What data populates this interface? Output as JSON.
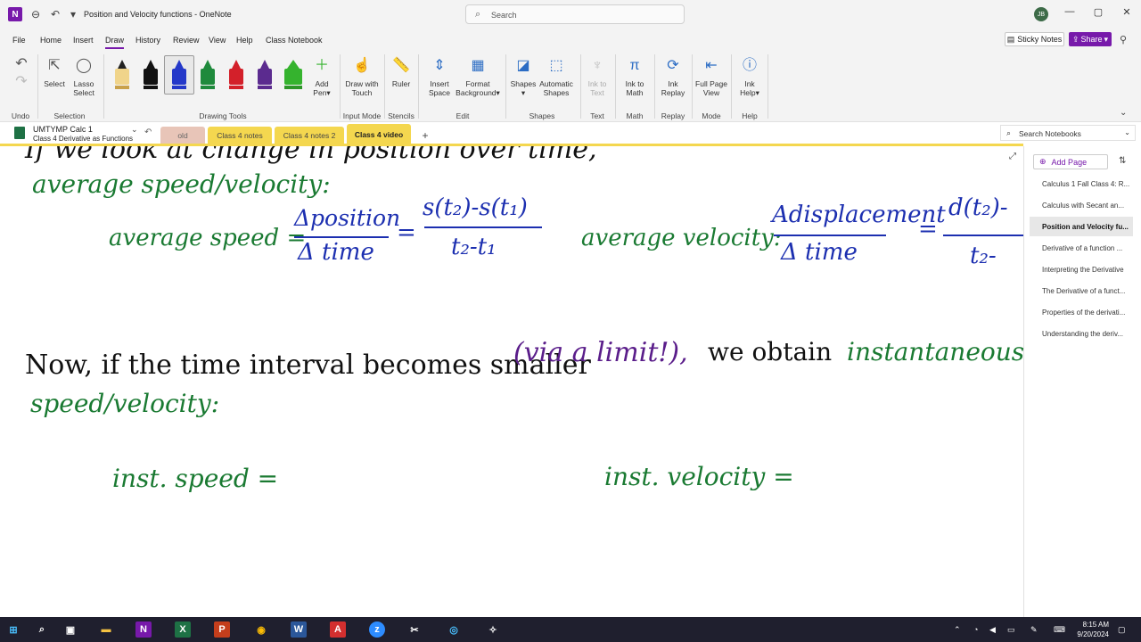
{
  "titlebar": {
    "doc_title": "Position and Velocity functions",
    "app_name": "OneNote",
    "search_placeholder": "Search",
    "avatar_initials": "JB"
  },
  "menu": {
    "tabs": [
      "File",
      "Home",
      "Insert",
      "Draw",
      "History",
      "Review",
      "View",
      "Help",
      "Class Notebook"
    ],
    "active": "Draw",
    "sticky_notes": "Sticky Notes",
    "share": "Share"
  },
  "ribbon": {
    "undo_group": "Undo",
    "select": "Select",
    "lasso_1": "Lasso",
    "lasso_2": "Select",
    "selection_group": "Selection",
    "add_pen_1": "Add",
    "add_pen_2": "Pen",
    "drawing_tools_group": "Drawing Tools",
    "draw_touch_1": "Draw with",
    "draw_touch_2": "Touch",
    "input_mode_group": "Input Mode",
    "ruler": "Ruler",
    "stencils_group": "Stencils",
    "insert_space_1": "Insert",
    "insert_space_2": "Space",
    "format_bg_1": "Format",
    "format_bg_2": "Background",
    "edit_group": "Edit",
    "shapes": "Shapes",
    "auto_shapes_1": "Automatic",
    "auto_shapes_2": "Shapes",
    "shapes_group": "Shapes",
    "ink_text_1": "Ink to",
    "ink_text_2": "Text",
    "text_group": "Text",
    "ink_math_1": "Ink to",
    "ink_math_2": "Math",
    "math_group": "Math",
    "ink_replay_1": "Ink",
    "ink_replay_2": "Replay",
    "replay_group": "Replay",
    "full_page_1": "Full Page",
    "full_page_2": "View",
    "mode_group": "Mode",
    "ink_help_1": "Ink",
    "ink_help_2": "Help",
    "help_group": "Help",
    "pen_colors": [
      "#c9a14a",
      "#111111",
      "#2438c9",
      "#1f8a3c",
      "#d3202a",
      "#5b2b8f",
      "#35b32e"
    ]
  },
  "notebook": {
    "name": "UMTYMP Calc 1",
    "section": "Class 4 Derivative as Functions",
    "tabs": [
      {
        "label": "old",
        "color": "#e8c5b8"
      },
      {
        "label": "Class 4 notes",
        "color": "#f4d74f"
      },
      {
        "label": "Class 4 notes 2",
        "color": "#f4d74f"
      },
      {
        "label": "Class 4 video",
        "color": "#f4d74f"
      }
    ],
    "active_tab": "Class 4 video",
    "search_notebooks": "Search Notebooks"
  },
  "canvas": {
    "line0": "If we look at change in position over time,",
    "line1": "average speed/velocity:",
    "avg_speed_label": "average speed =",
    "avg_speed_num": "Δposition",
    "avg_speed_den": "Δ time",
    "avg_speed_eq": "=",
    "avg_speed_rhs_num": "s(t₂)-s(t₁)",
    "avg_speed_rhs_den": "t₂-t₁",
    "avg_vel_label": "average velocity:",
    "avg_vel_num": "Adisplacement",
    "avg_vel_den": "Δ time",
    "avg_vel_eq": "=",
    "avg_vel_rhs_num": "d(t₂)-",
    "avg_vel_rhs_den": "t₂-",
    "now_line": "Now, if the time interval becomes smaller",
    "via_limit": "(via a limit!),",
    "we_obtain": "we obtain",
    "instantaneous": "instantaneous",
    "speed_vel": "speed/velocity:",
    "inst_speed": "inst. speed =",
    "inst_velocity": "inst. velocity ="
  },
  "pages": {
    "add_page": "Add Page",
    "items": [
      "Calculus 1 Fall Class 4: R...",
      "Calculus with Secant an...",
      "Position and Velocity fu...",
      "Derivative of a function ...",
      "Interpreting the Derivative",
      "The Derivative of a funct...",
      "Properties of the derivati...",
      "Understanding the deriv..."
    ],
    "active_index": 2
  },
  "taskbar": {
    "time": "8:15 AM",
    "date": "9/20/2024"
  }
}
